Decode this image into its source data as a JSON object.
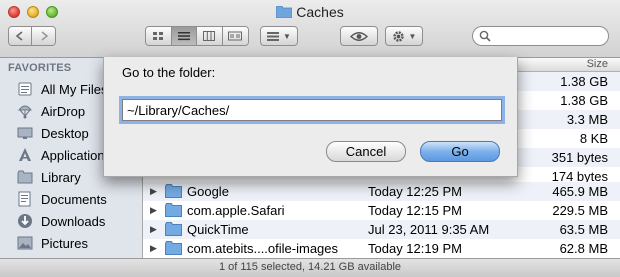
{
  "window": {
    "title": "Caches",
    "title_icon": "folder-icon"
  },
  "toolbar": {
    "nav_back_icon": "back-arrow-icon",
    "nav_forward_icon": "forward-arrow-icon",
    "view_modes": [
      "icon-view-icon",
      "list-view-icon",
      "column-view-icon",
      "coverflow-view-icon"
    ],
    "active_view": "list-view-icon",
    "arrange_icon": "arrange-grid-icon",
    "quicklook_icon": "eye-icon",
    "action_icon": "gear-icon",
    "search_icon": "search-icon"
  },
  "sidebar": {
    "header": "FAVORITES",
    "items": [
      {
        "label": "All My Files",
        "icon": "all-files-icon"
      },
      {
        "label": "AirDrop",
        "icon": "airdrop-icon"
      },
      {
        "label": "Desktop",
        "icon": "desktop-icon"
      },
      {
        "label": "Applications",
        "icon": "applications-icon"
      },
      {
        "label": "Library",
        "icon": "folder-icon"
      },
      {
        "label": "Documents",
        "icon": "documents-icon"
      },
      {
        "label": "Downloads",
        "icon": "downloads-icon"
      },
      {
        "label": "Pictures",
        "icon": "pictures-icon"
      }
    ]
  },
  "list": {
    "header_size": "Size",
    "rows": [
      {
        "name": "",
        "date": "",
        "size": "1.38 GB"
      },
      {
        "name": "",
        "date": "",
        "size": "1.38 GB"
      },
      {
        "name": "",
        "date": "",
        "size": "3.3 MB"
      },
      {
        "name": "",
        "date": "",
        "size": "8 KB"
      },
      {
        "name": "",
        "date": "",
        "size": "351 bytes"
      },
      {
        "name": "",
        "date": "",
        "size": "174 bytes"
      },
      {
        "name": "Google",
        "date": "Today 12:25 PM",
        "size": "465.9 MB"
      },
      {
        "name": "com.apple.Safari",
        "date": "Today 12:15 PM",
        "size": "229.5 MB"
      },
      {
        "name": "QuickTime",
        "date": "Jul 23, 2011 9:35 AM",
        "size": "63.5 MB"
      },
      {
        "name": "com.atebits....ofile-images",
        "date": "Today 12:19 PM",
        "size": "62.8 MB"
      }
    ]
  },
  "status": {
    "text": "1 of 115 selected, 14.21 GB available"
  },
  "sheet": {
    "label": "Go to the folder:",
    "input_value": "~/Library/Caches/",
    "cancel_label": "Cancel",
    "go_label": "Go"
  }
}
